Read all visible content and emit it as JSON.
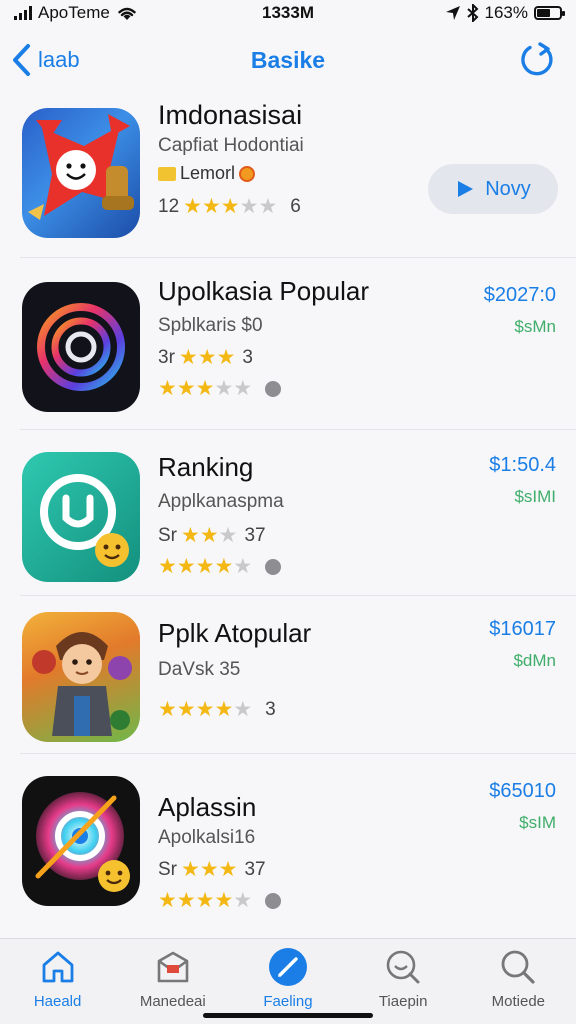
{
  "status_bar": {
    "carrier": "ApoTeme",
    "time": "1333M",
    "battery": "163%"
  },
  "nav": {
    "back_label": "laab",
    "title": "Basike"
  },
  "apps": [
    {
      "name": "Imdonasisai",
      "subtitle": "Capfiat Hodontiai",
      "badge_label": "Lemorl",
      "rating_prefix": "12",
      "rating_count": "6",
      "stars": 3,
      "action_label": "Novy"
    },
    {
      "name": "Upolkasia Popular",
      "subtitle": "Spblkaris $0",
      "rating_prefix": "3r",
      "rating_suffix": "3",
      "stars": 3,
      "stars2": 3,
      "price": "$2027:0",
      "price_sub": "$sMn"
    },
    {
      "name": "Ranking",
      "subtitle": "Applkanaspma",
      "rating_prefix": "Sr",
      "rating_suffix": "37",
      "stars": 2,
      "stars2": 4,
      "price": "$1:50.4",
      "price_sub": "$sIMI"
    },
    {
      "name": "Pplk Atopular",
      "subtitle": "DaVsk 35",
      "rating_suffix2": "3",
      "stars2": 4,
      "price": "$16017",
      "price_sub": "$dMn"
    },
    {
      "name": "Aplassin",
      "subtitle": "Apolkalsi16",
      "rating_prefix": "Sr",
      "rating_suffix": "37",
      "stars": 3,
      "stars2": 4,
      "price": "$65010",
      "price_sub": "$sIM"
    }
  ],
  "tabs": [
    {
      "label": "Haeald",
      "icon": "home-icon"
    },
    {
      "label": "Manedeai",
      "icon": "inbox-icon"
    },
    {
      "label": "Faeling",
      "icon": "brush-icon"
    },
    {
      "label": "Tiaepin",
      "icon": "smile-search-icon"
    },
    {
      "label": "Motiede",
      "icon": "search-icon"
    }
  ],
  "colors": {
    "accent": "#1a7ee6",
    "star": "#f3b814",
    "price_sub": "#3fae6a"
  }
}
